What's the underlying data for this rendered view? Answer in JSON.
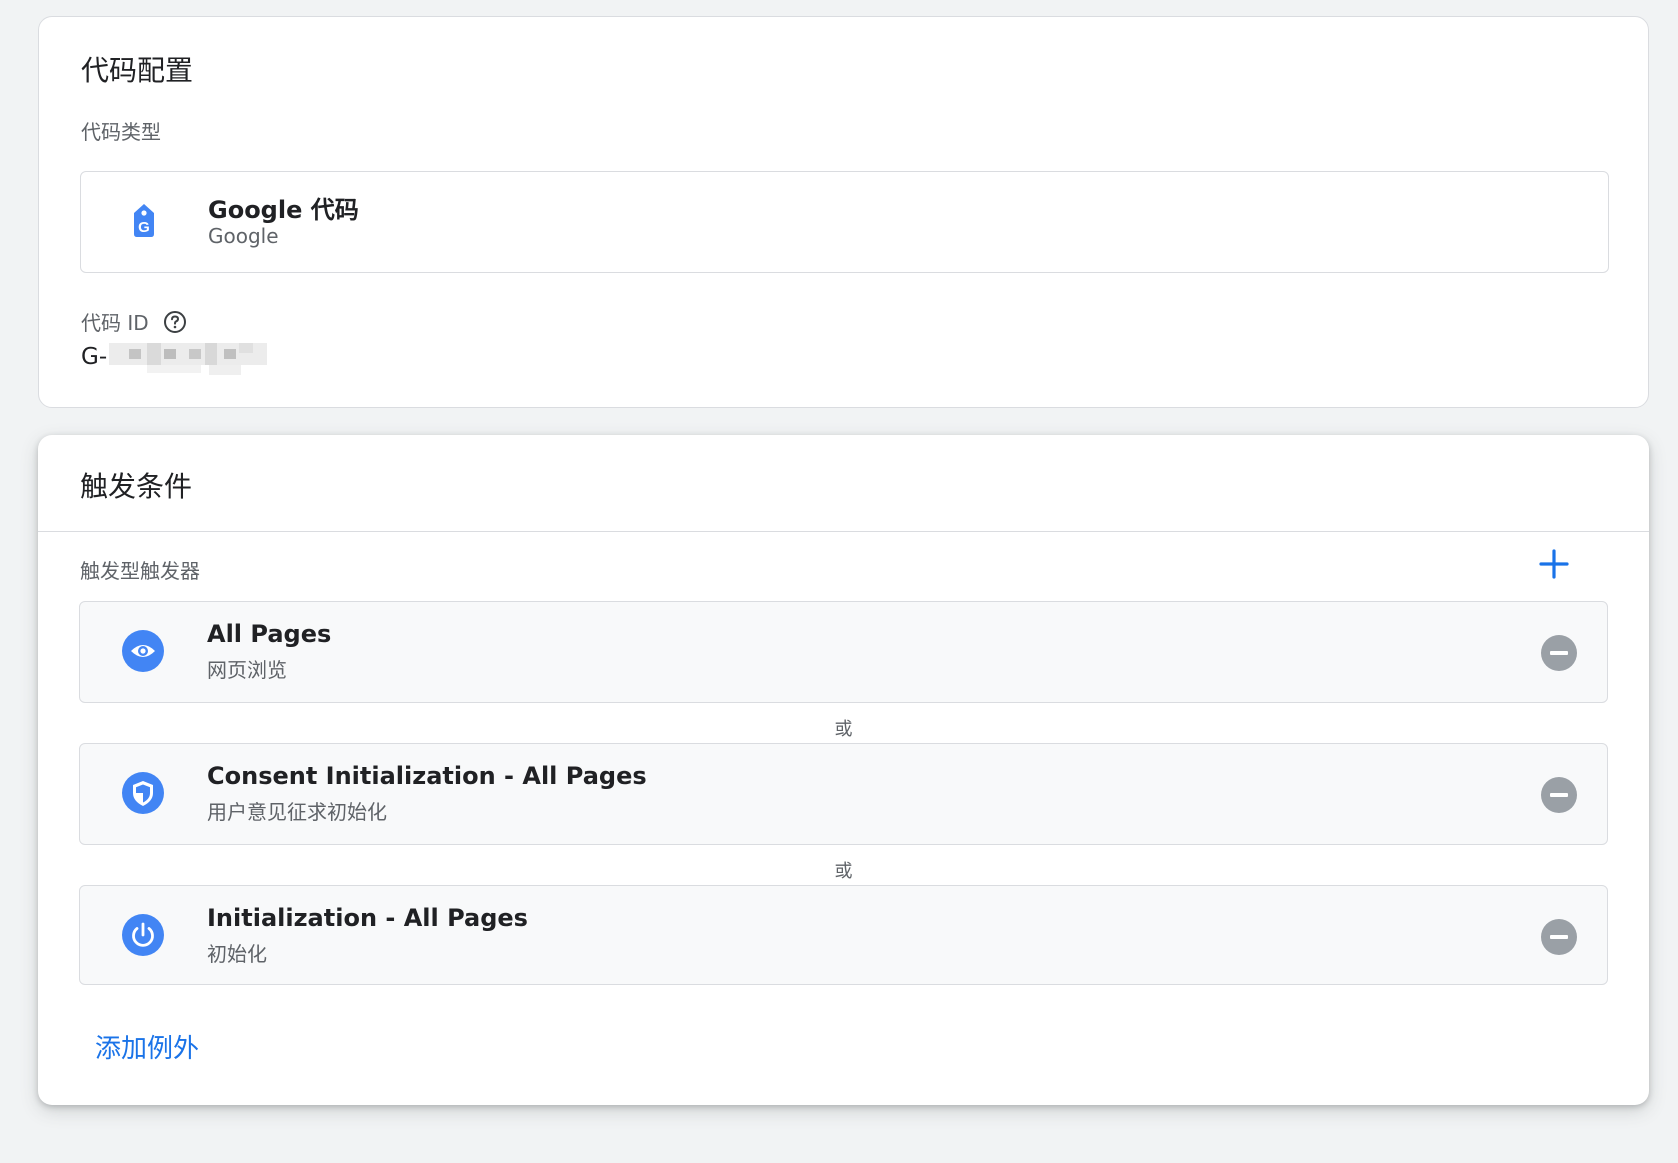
{
  "config": {
    "title": "代码配置",
    "type_label": "代码类型",
    "tag_type": {
      "icon": "google-tag-icon",
      "name": "Google 代码",
      "vendor": "Google"
    },
    "id_label": "代码 ID",
    "id_help_icon": "help-circle-icon",
    "id_prefix": "G-"
  },
  "triggers": {
    "title": "触发条件",
    "firing_label": "触发型触发器",
    "add_icon": "plus-icon",
    "accent_color": "#4285f4",
    "items": [
      {
        "icon": "eye-icon",
        "name": "All Pages",
        "type": "网页浏览"
      },
      {
        "icon": "shield-icon",
        "name": "Consent Initialization - All Pages",
        "type": "用户意见征求初始化"
      },
      {
        "icon": "power-icon",
        "name": "Initialization - All Pages",
        "type": "初始化"
      }
    ],
    "or_label": "或",
    "add_exception": "添加例外"
  }
}
